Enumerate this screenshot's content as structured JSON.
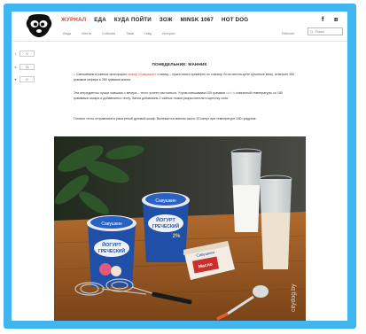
{
  "header": {
    "nav": [
      "ЖУРНАЛ",
      "ЕДА",
      "КУДА ПОЙТИ",
      "ЗОЖ",
      "MINSK 1067",
      "HOT DOG"
    ],
    "active_index": 0,
    "social": {
      "facebook": "f",
      "vk": "в"
    },
    "subnav": [
      "Люди",
      "Места",
      "События",
      "Тема",
      "Гайд",
      "История"
    ],
    "subnav_right": "Рабочее",
    "search_placeholder": "Поиск"
  },
  "share": [
    {
      "icon": "facebook-icon",
      "symbol": "f",
      "count": "0"
    },
    {
      "icon": "vk-icon",
      "symbol": "в",
      "count": "71"
    },
    {
      "icon": "heart-icon",
      "symbol": "♥",
      "count": "0"
    }
  ],
  "article": {
    "title": "ПОНЕДЕЛЬНИК: МАННИК",
    "p1_lead": "– Смешиваем в равных пропорциях ",
    "p1_link": "кефир «Савушкин»",
    "p1_rest": " и манку – нужно взять примерно по стакану. Если используете кухонные весы, отмерьте 350 граммов кефира и 250 граммов манки.",
    "p2_lead": "Эти ингредиенты лучше смешать с вечера – тесто успеет настояться. Утром смешиваем 100 граммов ",
    "p2_hl": "масла",
    "p2_rest": " комнатной температуры со 180 граммами сахара и добавляем к тесту. Затем добавляем 2 чайные ложки разрыхлителя и щепотку соли.",
    "p3": "Готовое тесто отправляем в разогретый духовой шкаф. Выпекается манник около 20 минут при температуре 180 градусов.",
    "photo": {
      "yogurt_brand": "Савушкин",
      "yogurt_label_1": "ЙОГУРТ",
      "yogurt_label_2": "ГРЕЧЕСКИЙ",
      "yogurt_fat": "2%",
      "butter_brand": "Савушкин",
      "butter_label": "Масло",
      "watermark": "citydog.by"
    }
  },
  "colors": {
    "accent": "#e0412b",
    "frame": "#3fb6f0"
  }
}
